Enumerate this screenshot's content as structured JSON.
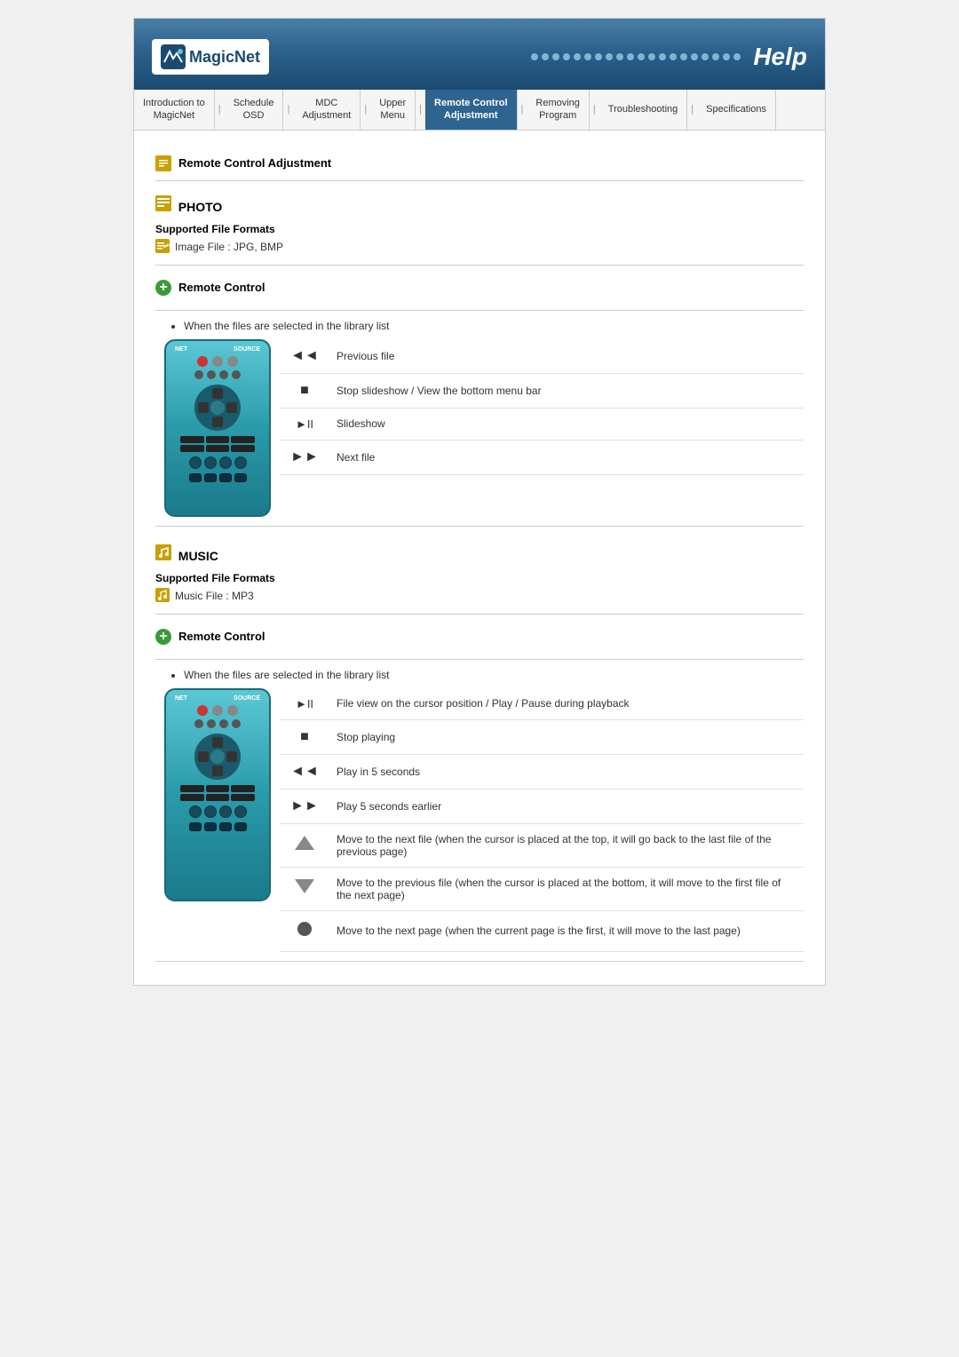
{
  "header": {
    "logo_text": "MagicNet",
    "help_text": "Help"
  },
  "navbar": {
    "items": [
      {
        "label": "Introduction to\nMagicNet",
        "active": false
      },
      {
        "label": "Schedule\nOSD",
        "active": false
      },
      {
        "label": "MDC\nAdjustment",
        "active": false
      },
      {
        "label": "Upper\nMenu",
        "active": false
      },
      {
        "label": "Remote Control\nAdjustment",
        "active": true
      },
      {
        "label": "Removing\nProgram",
        "active": false
      },
      {
        "label": "Troubleshooting",
        "active": false
      },
      {
        "label": "Specifications",
        "active": false
      }
    ]
  },
  "page": {
    "breadcrumb": "Remote Control Adjustment",
    "photo_section": {
      "title": "PHOTO",
      "supported_formats_label": "Supported File Formats",
      "format_item": "Image File : JPG, BMP",
      "remote_control_label": "Remote Control",
      "library_note": "When the files are selected in the library list",
      "keys": [
        {
          "symbol": "◄◄",
          "description": "Previous file"
        },
        {
          "symbol": "■",
          "description": "Stop slideshow / View the bottom menu bar"
        },
        {
          "symbol": "►II",
          "description": "Slideshow"
        },
        {
          "symbol": "►►",
          "description": "Next file"
        }
      ]
    },
    "music_section": {
      "title": "MUSIC",
      "supported_formats_label": "Supported File Formats",
      "format_item": "Music File : MP3",
      "remote_control_label": "Remote Control",
      "library_note": "When the files are selected in the library list",
      "keys": [
        {
          "symbol": "►II",
          "description": "File view on the cursor position / Play / Pause during playback"
        },
        {
          "symbol": "■",
          "description": "Stop playing"
        },
        {
          "symbol": "◄◄",
          "description": "Play in 5 seconds"
        },
        {
          "symbol": "►►",
          "description": "Play 5 seconds earlier"
        },
        {
          "symbol": "▲",
          "description": "Move to the next file (when the cursor is placed at the top, it will go back to the last file of the previous page)"
        },
        {
          "symbol": "▼",
          "description": "Move to the previous file (when the cursor is placed at the bottom, it will move to the first file of the next page)"
        },
        {
          "symbol": "●",
          "description": "Move to the next page (when the current page is the first, it will move to the last page)"
        }
      ]
    }
  }
}
